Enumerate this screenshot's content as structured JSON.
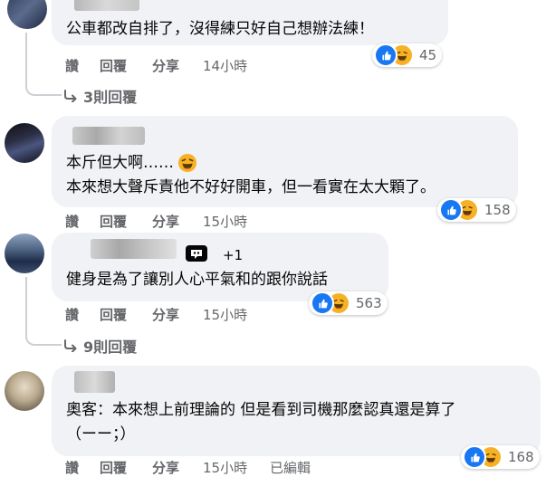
{
  "actions": {
    "like": "讚",
    "reply": "回覆",
    "share": "分享"
  },
  "comments": [
    {
      "text_lines": [
        "公車都改自排了，沒得練只好自己想辦法練！"
      ],
      "time": "14小時",
      "reaction_count": "45",
      "replies_label": "3則回覆"
    },
    {
      "text_lines": [
        "本斤但大啊……",
        "本來想大聲斥責他不好好開車，但一看實在太大顆了。"
      ],
      "time": "15小時",
      "reaction_count": "158"
    },
    {
      "badge_count": "+1",
      "text_lines": [
        "健身是為了讓別人心平氣和的跟你說話"
      ],
      "time": "15小時",
      "reaction_count": "563",
      "replies_label": "9則回覆"
    },
    {
      "text_lines": [
        "奧客：本來想上前理論的 但是看到司機那麼認真還是算了",
        "（ーー；）"
      ],
      "time": "15小時",
      "edited": "已編輯",
      "reaction_count": "168"
    }
  ],
  "icons": {
    "like": "thumbs-up-icon",
    "haha": "laughing-face-icon",
    "reply_arrow": "reply-arrow-icon",
    "badge": "top-fan-badge-icon"
  },
  "colors": {
    "bubble": "#f0f2f5",
    "meta": "#65676b",
    "like_blue": "#1877f2",
    "haha_yellow": "#f7b125"
  }
}
